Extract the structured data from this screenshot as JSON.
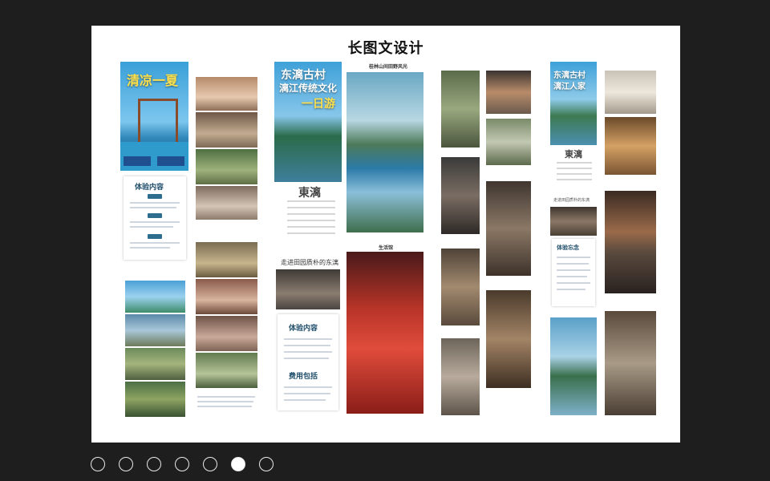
{
  "slide": {
    "title": "长图文设计"
  },
  "posters": {
    "p1_title": "清凉一夏",
    "p2_title_line1": "东漓古村",
    "p2_title_line2": "漓江传统文化",
    "p2_title_line3": "一日游",
    "p6_title_line1": "东漓古村",
    "p6_title_line2": "漓江人家"
  },
  "cards": {
    "c1_title": "体验内容",
    "c2_title": "体验内容",
    "c2_sub": "费用包括",
    "c3_title": "体验忘念",
    "dongli_big": "東漓",
    "dongli_big2": "東漓",
    "caption_a": "走进田园质朴的东漓",
    "caption_b": "走进田园质朴的东漓",
    "hill_caption": "桂林山间田野风光",
    "wedding_caption": "生活馆"
  },
  "pager": {
    "total": 7,
    "active_index": 5
  }
}
